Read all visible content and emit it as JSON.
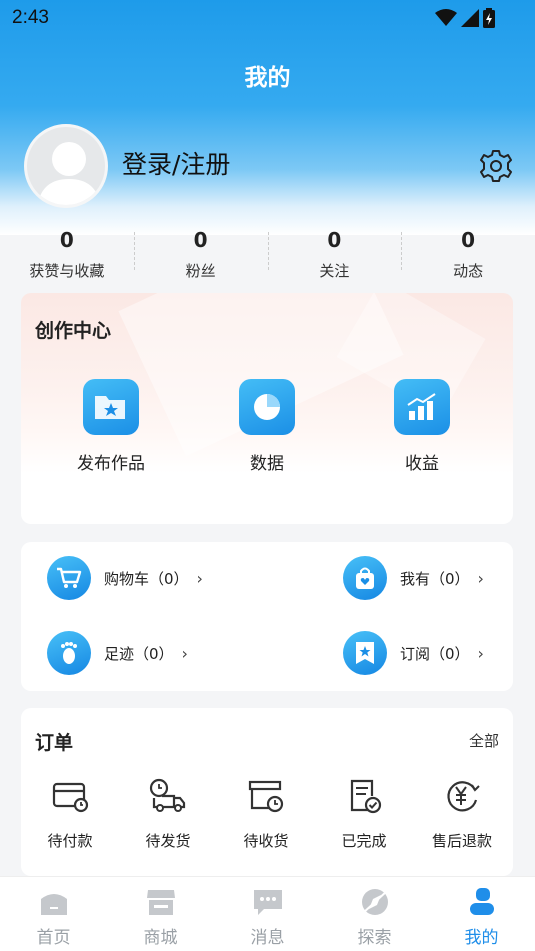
{
  "status_bar": {
    "time": "2:43"
  },
  "header": {
    "title": "我的"
  },
  "profile": {
    "login_label": "登录/注册"
  },
  "stats": [
    {
      "value": "0",
      "label": "获赞与收藏"
    },
    {
      "value": "0",
      "label": "粉丝"
    },
    {
      "value": "0",
      "label": "关注"
    },
    {
      "value": "0",
      "label": "动态"
    }
  ],
  "creator_center": {
    "title": "创作中心",
    "items": [
      {
        "label": "发布作品",
        "icon": "folder-star-icon"
      },
      {
        "label": "数据",
        "icon": "pie-chart-icon"
      },
      {
        "label": "收益",
        "icon": "bar-chart-icon"
      }
    ]
  },
  "shortcuts": [
    {
      "label": "购物车（0）",
      "icon": "cart-icon"
    },
    {
      "label": "我有（0）",
      "icon": "bag-heart-icon"
    },
    {
      "label": "足迹（0）",
      "icon": "footprint-icon"
    },
    {
      "label": "订阅（0）",
      "icon": "bookmark-star-icon"
    }
  ],
  "orders": {
    "title": "订单",
    "all_label": "全部",
    "items": [
      {
        "label": "待付款",
        "icon": "card-clock-icon"
      },
      {
        "label": "待发货",
        "icon": "truck-clock-icon"
      },
      {
        "label": "待收货",
        "icon": "box-clock-icon"
      },
      {
        "label": "已完成",
        "icon": "doc-check-icon"
      },
      {
        "label": "售后退款",
        "icon": "yen-refund-icon"
      }
    ]
  },
  "tabs": [
    {
      "label": "首页",
      "icon": "home-icon"
    },
    {
      "label": "商城",
      "icon": "store-icon"
    },
    {
      "label": "消息",
      "icon": "message-icon"
    },
    {
      "label": "探索",
      "icon": "compass-icon"
    },
    {
      "label": "我的",
      "icon": "user-icon",
      "active": true
    }
  ],
  "colors": {
    "accent": "#1f8ee9",
    "inactive": "#9aa0a6"
  }
}
